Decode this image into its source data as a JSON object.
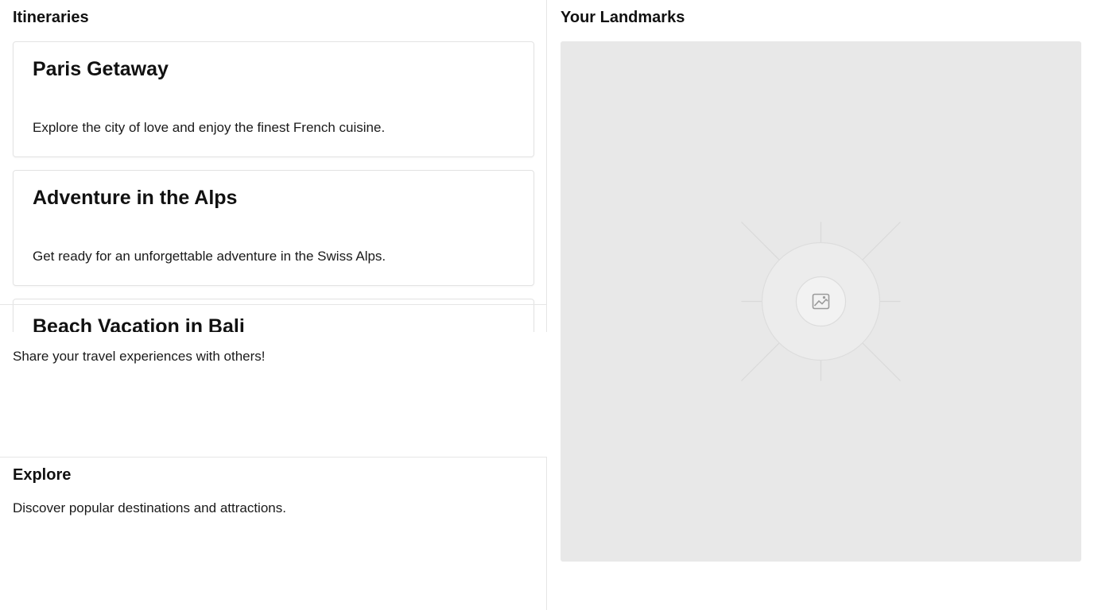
{
  "itineraries": {
    "title": "Itineraries",
    "items": [
      {
        "title": "Paris Getaway",
        "description": "Explore the city of love and enjoy the finest French cuisine."
      },
      {
        "title": "Adventure in the Alps",
        "description": "Get ready for an unforgettable adventure in the Swiss Alps."
      },
      {
        "title": "Beach Vacation in Bali",
        "description": ""
      }
    ]
  },
  "share": {
    "text": "Share your travel experiences with others!"
  },
  "explore": {
    "title": "Explore",
    "text": "Discover popular destinations and attractions."
  },
  "landmarks": {
    "title": "Your Landmarks",
    "placeholder_icon": "image-icon"
  },
  "colors": {
    "placeholder_bg": "#e8e8e8",
    "border": "#e3e3e3",
    "text": "#111111"
  }
}
